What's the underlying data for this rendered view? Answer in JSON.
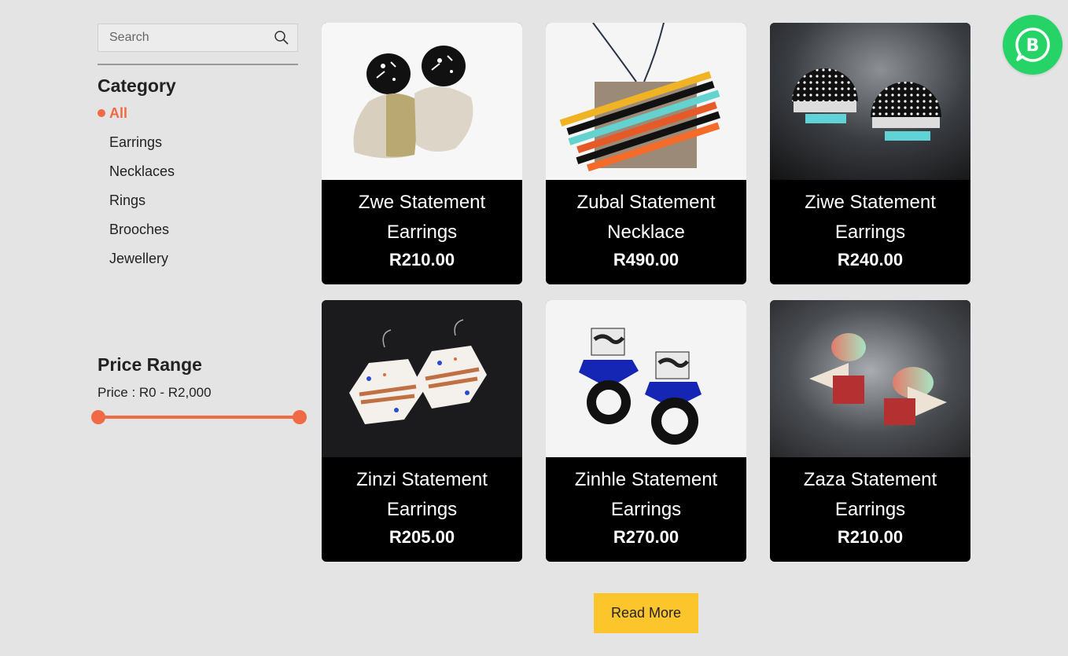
{
  "search": {
    "placeholder": "Search"
  },
  "category": {
    "title": "Category",
    "items": [
      {
        "label": "All",
        "active": true
      },
      {
        "label": "Earrings"
      },
      {
        "label": "Necklaces"
      },
      {
        "label": "Rings"
      },
      {
        "label": "Brooches"
      },
      {
        "label": "Jewellery"
      }
    ]
  },
  "price_range": {
    "title": "Price Range",
    "label": "Price : R0 - R2,000",
    "min": 0,
    "max": 2000,
    "selected_min": 0,
    "selected_max": 2000
  },
  "products": [
    {
      "name": "Zwe Statement Earrings",
      "price": "R210.00"
    },
    {
      "name": "Zubal Statement Necklace",
      "price": "R490.00"
    },
    {
      "name": "Ziwe Statement Earrings",
      "price": "R240.00"
    },
    {
      "name": "Zinzi Statement Earrings",
      "price": "R205.00"
    },
    {
      "name": "Zinhle Statement Earrings",
      "price": "R270.00"
    },
    {
      "name": "Zaza Statement Earrings",
      "price": "R210.00"
    }
  ],
  "read_more": {
    "label": "Read More"
  },
  "colors": {
    "accent": "#ef6a45",
    "button": "#fdc52c",
    "whatsapp": "#25d366",
    "card_bg": "#000000"
  },
  "icons": {
    "search": "search-icon",
    "whatsapp": "whatsapp-business-icon"
  }
}
